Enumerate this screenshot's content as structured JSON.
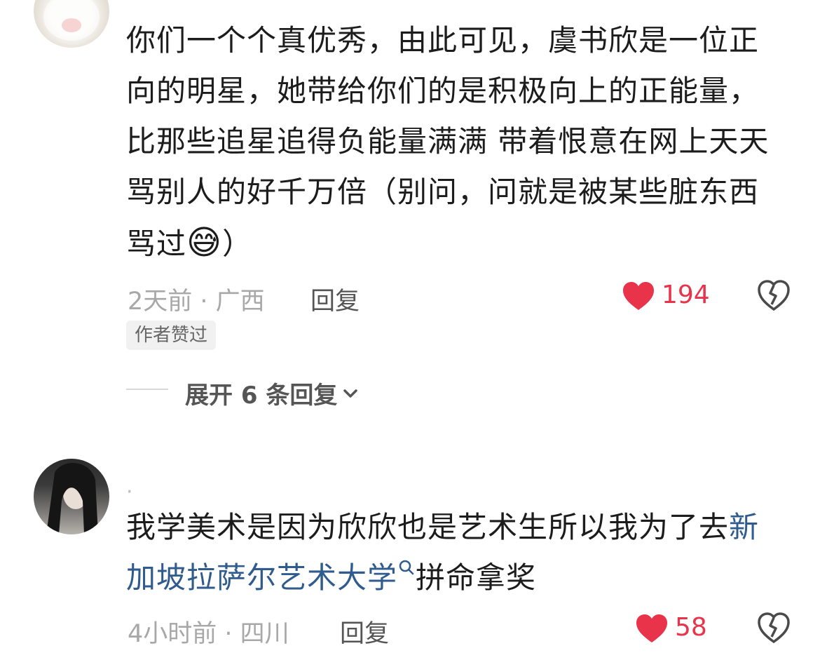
{
  "comments": [
    {
      "text_lines": [
        "你们一个个真优秀，由此可见，虞书欣是一位正",
        "向的明星，她带给你们的是积极向上的正能量，",
        "比那些追星追得负能量满满  带着恨意在网上天天",
        "骂别人的好千万倍（别问，问就是被某些脏东西",
        "骂过"
      ],
      "text_tail": "）",
      "emoji": "😅",
      "time_location": "2天前 · 广西",
      "reply_label": "回复",
      "likes": "194",
      "badge": "作者赞过",
      "expand_label": "展开 6 条回复"
    },
    {
      "name": "·",
      "text_line1_plain": "我学美术是因为欣欣也是艺术生所以我为了去",
      "text_line1_link": "新",
      "text_line2_link": "加坡拉萨尔艺术大学",
      "text_line2_rest": "拼命拿奖",
      "time_location": "4小时前 · 四川",
      "reply_label": "回复",
      "likes": "58"
    }
  ],
  "colors": {
    "like_red": "#e8334a",
    "link_blue": "#2f5b8e"
  },
  "icons": [
    "avatar",
    "emoji",
    "heart-icon",
    "broken-heart-icon",
    "chevron-down-icon",
    "search-icon"
  ]
}
